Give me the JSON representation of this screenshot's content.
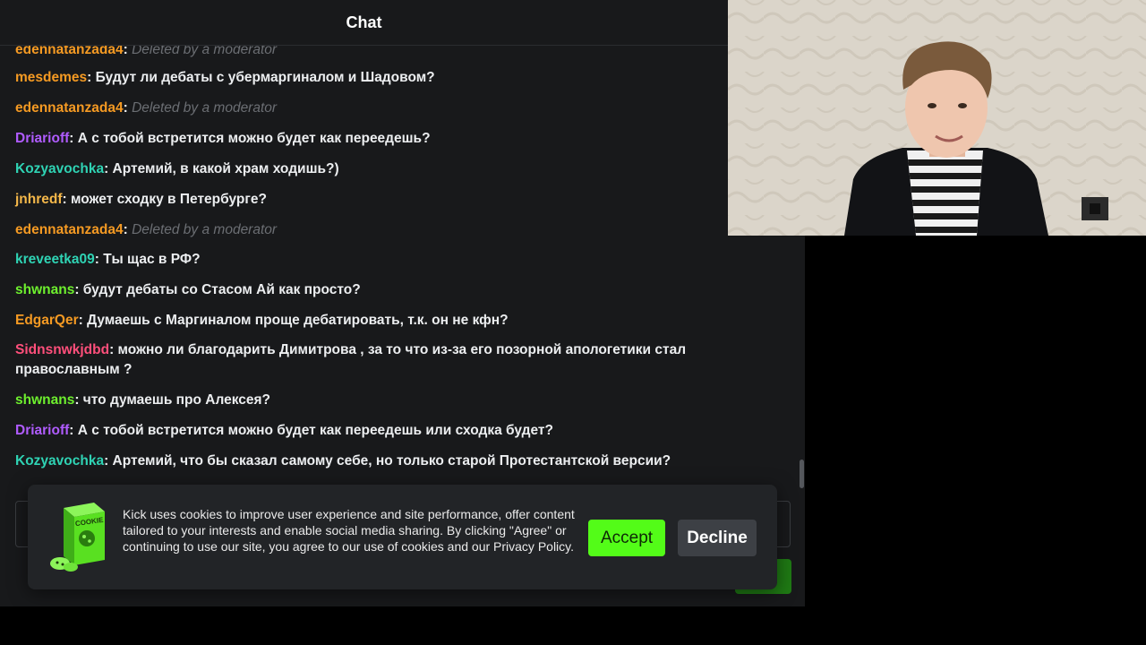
{
  "chat": {
    "title": "Chat",
    "messages": [
      {
        "user": "edennatanzada4",
        "color": "#f59a23",
        "text": "Deleted by a moderator",
        "deleted": true
      },
      {
        "user": "mesdemes",
        "color": "#f59a23",
        "text": "Будут ли дебаты с убермаргиналом и Шадовом?",
        "deleted": false
      },
      {
        "user": "edennatanzada4",
        "color": "#f59a23",
        "text": "Deleted by a moderator",
        "deleted": true
      },
      {
        "user": "Driarioff",
        "color": "#b05cff",
        "text": "А с тобой встретится можно будет как переедешь?",
        "deleted": false
      },
      {
        "user": "Kozyavochka",
        "color": "#2fd3b4",
        "text": "Артемий, в какой храм ходишь?)",
        "deleted": false
      },
      {
        "user": "jnhredf",
        "color": "#f5b84a",
        "text": "может сходку в Петербурге?",
        "deleted": false
      },
      {
        "user": "edennatanzada4",
        "color": "#f59a23",
        "text": "Deleted by a moderator",
        "deleted": true
      },
      {
        "user": "kreveetka09",
        "color": "#2fd3b4",
        "text": "Ты щас в РФ?",
        "deleted": false
      },
      {
        "user": "shwnans",
        "color": "#6ef02e",
        "text": "будут дебаты со Стасом Ай как просто?",
        "deleted": false
      },
      {
        "user": "EdgarQer",
        "color": "#f59a23",
        "text": "Думаешь с Маргиналом проще дебатировать, т.к. он не кфн?",
        "deleted": false
      },
      {
        "user": "Sidnsnwkjdbd",
        "color": "#ff4f7b",
        "text": "можно ли благодарить Димитрова , за то что из-за его позорной апологетики стал православным ?",
        "deleted": false
      },
      {
        "user": "shwnans",
        "color": "#6ef02e",
        "text": "что думаешь про Алексея?",
        "deleted": false
      },
      {
        "user": "Driarioff",
        "color": "#b05cff",
        "text": "А с тобой встретится можно будет как переедешь или сходка будет?",
        "deleted": false
      },
      {
        "user": "Kozyavochka",
        "color": "#2fd3b4",
        "text": "Артемий, что бы сказал самому себе, но только старой Протестантской версии?",
        "deleted": false
      }
    ]
  },
  "cookie_banner": {
    "icon": "cookie-box-icon",
    "icon_label": "COOKIE",
    "text": "Kick uses cookies to improve user experience and site performance, offer content tailored to your interests and enable social media sharing. By clicking \"Agree\" or continuing to use our site, you agree to our use of cookies and our Privacy Policy.",
    "accept_label": "Accept",
    "decline_label": "Decline"
  },
  "webcam": {
    "icon": "webcam-feed"
  },
  "colors": {
    "accent": "#53fc18",
    "panel": "#18191b",
    "banner": "#222427"
  }
}
